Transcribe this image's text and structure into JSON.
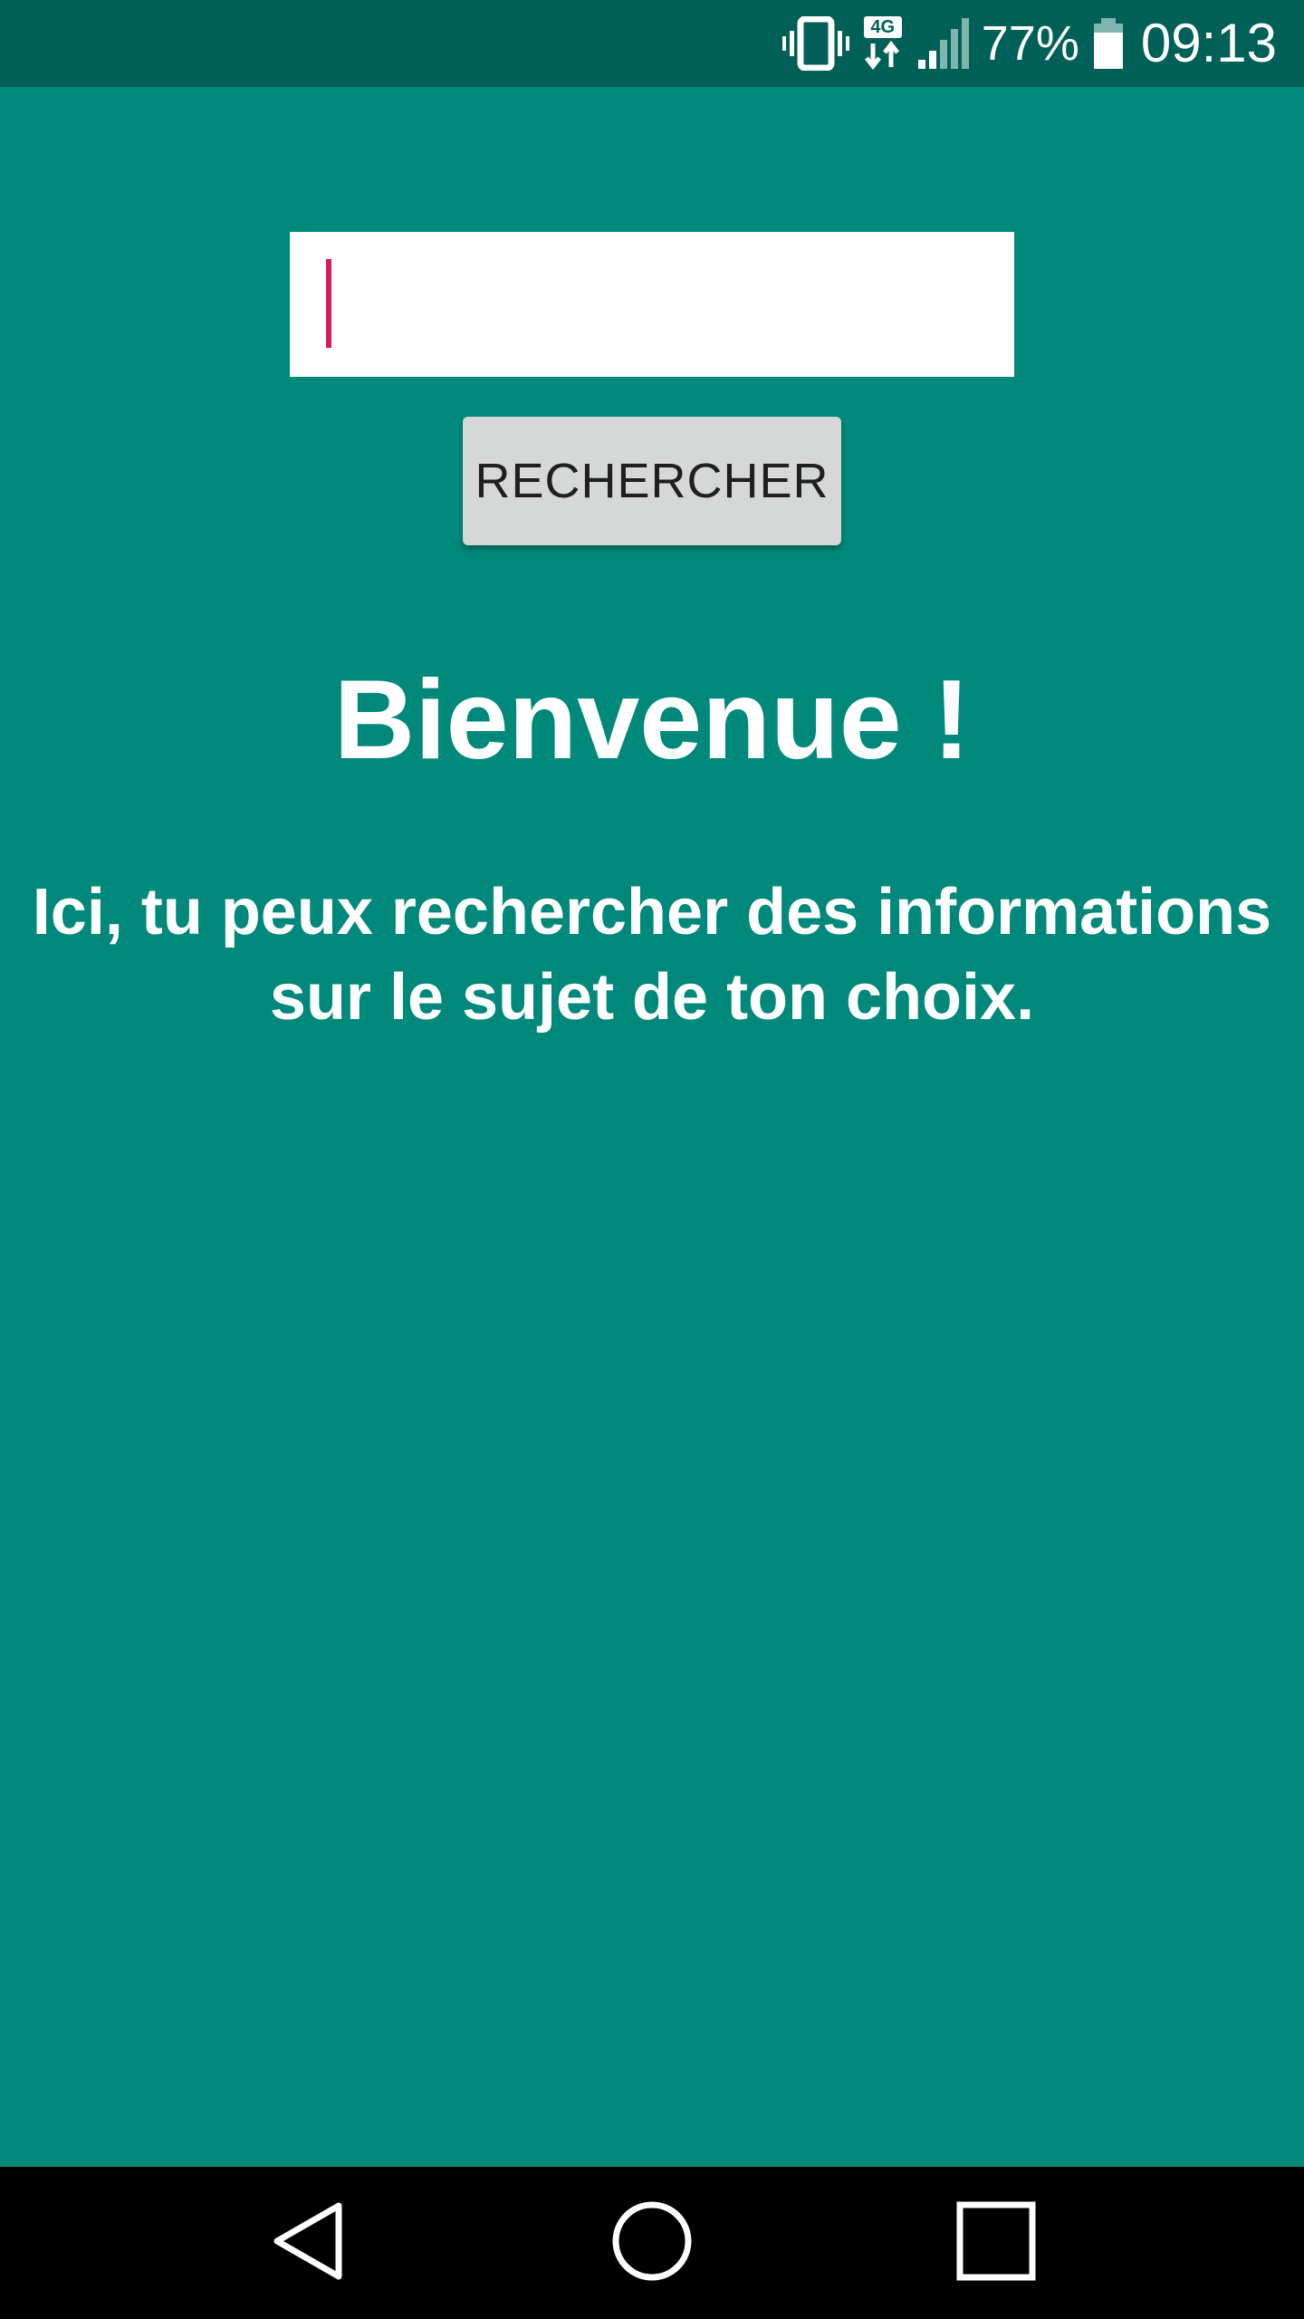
{
  "status_bar": {
    "battery_percent": "77%",
    "time": "09:13",
    "network_type": "4G",
    "icons": [
      "vibrate-icon",
      "network-4g-icon",
      "signal-icon",
      "battery-icon"
    ]
  },
  "search": {
    "value": "",
    "button_label": "RECHERCHER"
  },
  "welcome": {
    "title": "Bienvenue !",
    "text": "Ici, tu peux rechercher des informations sur le sujet de ton choix."
  },
  "nav_bar": {
    "icons": [
      "back-icon",
      "home-icon",
      "recents-icon"
    ]
  },
  "colors": {
    "background": "#00897B",
    "status_bar": "#005F56",
    "cursor": "#D81B60",
    "button": "#D6D7D7"
  }
}
